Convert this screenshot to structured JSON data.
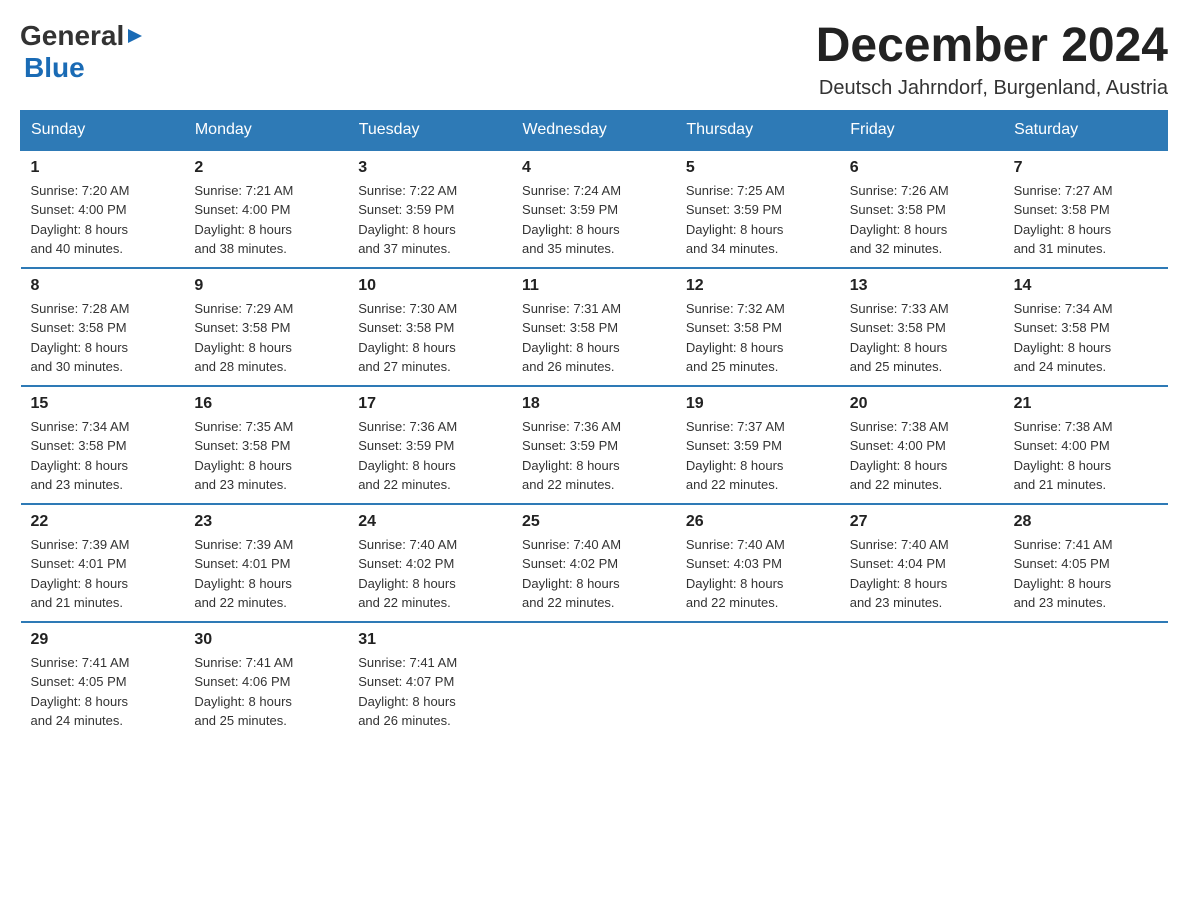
{
  "logo": {
    "text_general": "General",
    "text_blue": "Blue"
  },
  "header": {
    "month_title": "December 2024",
    "subtitle": "Deutsch Jahrndorf, Burgenland, Austria"
  },
  "weekdays": [
    "Sunday",
    "Monday",
    "Tuesday",
    "Wednesday",
    "Thursday",
    "Friday",
    "Saturday"
  ],
  "weeks": [
    [
      {
        "day": "1",
        "sunrise": "7:20 AM",
        "sunset": "4:00 PM",
        "daylight": "8 hours and 40 minutes."
      },
      {
        "day": "2",
        "sunrise": "7:21 AM",
        "sunset": "4:00 PM",
        "daylight": "8 hours and 38 minutes."
      },
      {
        "day": "3",
        "sunrise": "7:22 AM",
        "sunset": "3:59 PM",
        "daylight": "8 hours and 37 minutes."
      },
      {
        "day": "4",
        "sunrise": "7:24 AM",
        "sunset": "3:59 PM",
        "daylight": "8 hours and 35 minutes."
      },
      {
        "day": "5",
        "sunrise": "7:25 AM",
        "sunset": "3:59 PM",
        "daylight": "8 hours and 34 minutes."
      },
      {
        "day": "6",
        "sunrise": "7:26 AM",
        "sunset": "3:58 PM",
        "daylight": "8 hours and 32 minutes."
      },
      {
        "day": "7",
        "sunrise": "7:27 AM",
        "sunset": "3:58 PM",
        "daylight": "8 hours and 31 minutes."
      }
    ],
    [
      {
        "day": "8",
        "sunrise": "7:28 AM",
        "sunset": "3:58 PM",
        "daylight": "8 hours and 30 minutes."
      },
      {
        "day": "9",
        "sunrise": "7:29 AM",
        "sunset": "3:58 PM",
        "daylight": "8 hours and 28 minutes."
      },
      {
        "day": "10",
        "sunrise": "7:30 AM",
        "sunset": "3:58 PM",
        "daylight": "8 hours and 27 minutes."
      },
      {
        "day": "11",
        "sunrise": "7:31 AM",
        "sunset": "3:58 PM",
        "daylight": "8 hours and 26 minutes."
      },
      {
        "day": "12",
        "sunrise": "7:32 AM",
        "sunset": "3:58 PM",
        "daylight": "8 hours and 25 minutes."
      },
      {
        "day": "13",
        "sunrise": "7:33 AM",
        "sunset": "3:58 PM",
        "daylight": "8 hours and 25 minutes."
      },
      {
        "day": "14",
        "sunrise": "7:34 AM",
        "sunset": "3:58 PM",
        "daylight": "8 hours and 24 minutes."
      }
    ],
    [
      {
        "day": "15",
        "sunrise": "7:34 AM",
        "sunset": "3:58 PM",
        "daylight": "8 hours and 23 minutes."
      },
      {
        "day": "16",
        "sunrise": "7:35 AM",
        "sunset": "3:58 PM",
        "daylight": "8 hours and 23 minutes."
      },
      {
        "day": "17",
        "sunrise": "7:36 AM",
        "sunset": "3:59 PM",
        "daylight": "8 hours and 22 minutes."
      },
      {
        "day": "18",
        "sunrise": "7:36 AM",
        "sunset": "3:59 PM",
        "daylight": "8 hours and 22 minutes."
      },
      {
        "day": "19",
        "sunrise": "7:37 AM",
        "sunset": "3:59 PM",
        "daylight": "8 hours and 22 minutes."
      },
      {
        "day": "20",
        "sunrise": "7:38 AM",
        "sunset": "4:00 PM",
        "daylight": "8 hours and 22 minutes."
      },
      {
        "day": "21",
        "sunrise": "7:38 AM",
        "sunset": "4:00 PM",
        "daylight": "8 hours and 21 minutes."
      }
    ],
    [
      {
        "day": "22",
        "sunrise": "7:39 AM",
        "sunset": "4:01 PM",
        "daylight": "8 hours and 21 minutes."
      },
      {
        "day": "23",
        "sunrise": "7:39 AM",
        "sunset": "4:01 PM",
        "daylight": "8 hours and 22 minutes."
      },
      {
        "day": "24",
        "sunrise": "7:40 AM",
        "sunset": "4:02 PM",
        "daylight": "8 hours and 22 minutes."
      },
      {
        "day": "25",
        "sunrise": "7:40 AM",
        "sunset": "4:02 PM",
        "daylight": "8 hours and 22 minutes."
      },
      {
        "day": "26",
        "sunrise": "7:40 AM",
        "sunset": "4:03 PM",
        "daylight": "8 hours and 22 minutes."
      },
      {
        "day": "27",
        "sunrise": "7:40 AM",
        "sunset": "4:04 PM",
        "daylight": "8 hours and 23 minutes."
      },
      {
        "day": "28",
        "sunrise": "7:41 AM",
        "sunset": "4:05 PM",
        "daylight": "8 hours and 23 minutes."
      }
    ],
    [
      {
        "day": "29",
        "sunrise": "7:41 AM",
        "sunset": "4:05 PM",
        "daylight": "8 hours and 24 minutes."
      },
      {
        "day": "30",
        "sunrise": "7:41 AM",
        "sunset": "4:06 PM",
        "daylight": "8 hours and 25 minutes."
      },
      {
        "day": "31",
        "sunrise": "7:41 AM",
        "sunset": "4:07 PM",
        "daylight": "8 hours and 26 minutes."
      },
      null,
      null,
      null,
      null
    ]
  ],
  "labels": {
    "sunrise": "Sunrise:",
    "sunset": "Sunset:",
    "daylight": "Daylight:"
  },
  "colors": {
    "header_bg": "#2e7ab6",
    "header_text": "#ffffff",
    "border_top": "#2e7ab6"
  }
}
